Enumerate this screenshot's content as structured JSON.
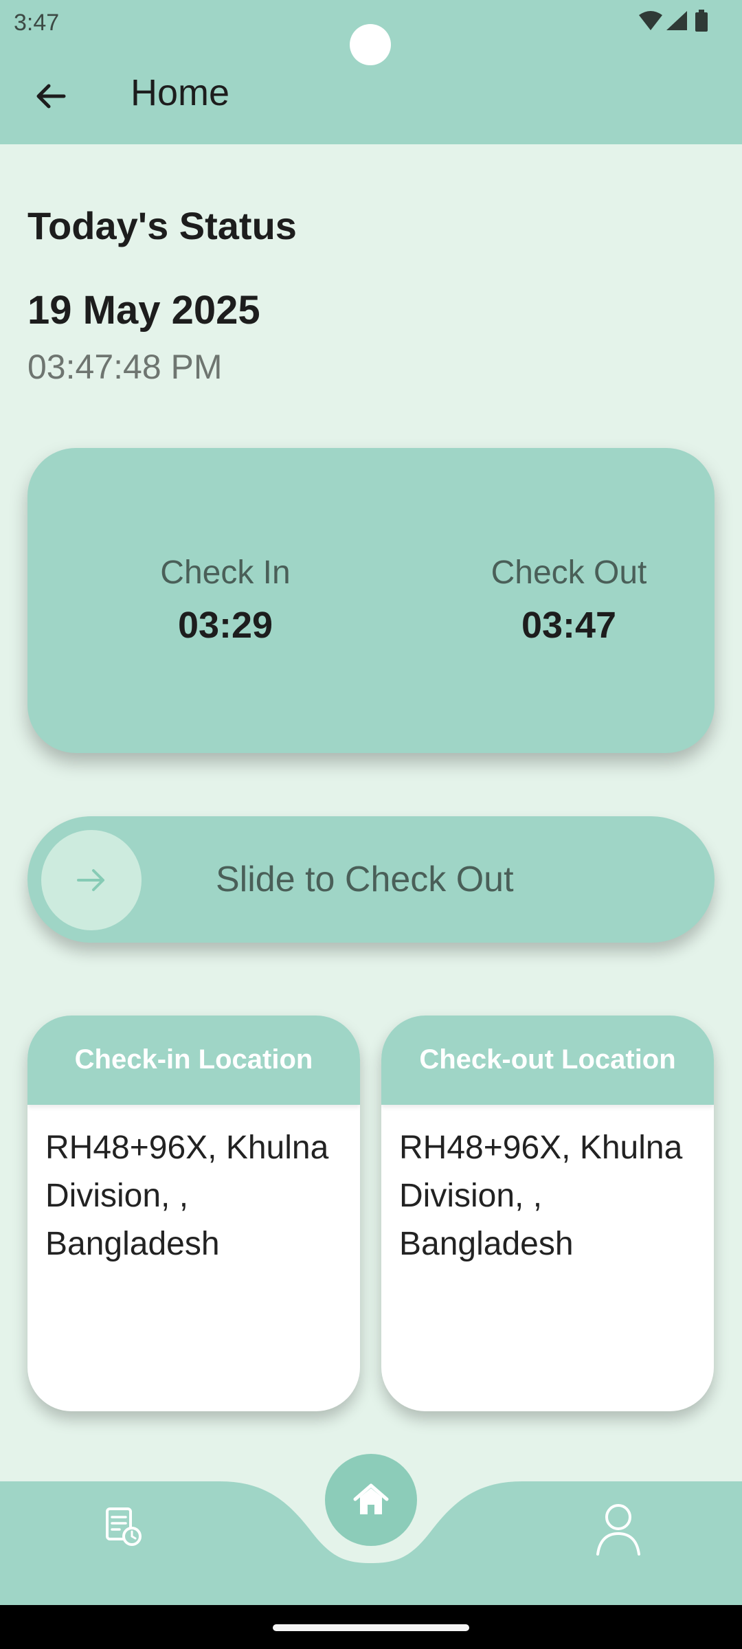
{
  "status_bar": {
    "time": "3:47"
  },
  "app_bar": {
    "title": "Home",
    "back_icon": "arrow-left-icon"
  },
  "status": {
    "heading": "Today's Status",
    "date": "19 May 2025",
    "time": "03:47:48 PM"
  },
  "check_card": {
    "check_in_label": "Check In",
    "check_in_time": "03:29",
    "check_out_label": "Check Out",
    "check_out_time": "03:47"
  },
  "slider": {
    "label": "Slide to Check Out",
    "icon": "arrow-right-icon"
  },
  "locations": {
    "check_in": {
      "title": "Check-in Location",
      "address": "RH48+96X, Khulna Division, , Bangladesh"
    },
    "check_out": {
      "title": "Check-out Location",
      "address": "RH48+96X, Khulna Division, , Bangladesh"
    }
  },
  "bottom_nav": {
    "items": [
      "history-icon",
      "home-icon",
      "profile-icon"
    ],
    "selected": "home-icon"
  },
  "colors": {
    "accent": "#9fd5c6",
    "background": "#e4f3ea",
    "card": "#ffffff"
  }
}
